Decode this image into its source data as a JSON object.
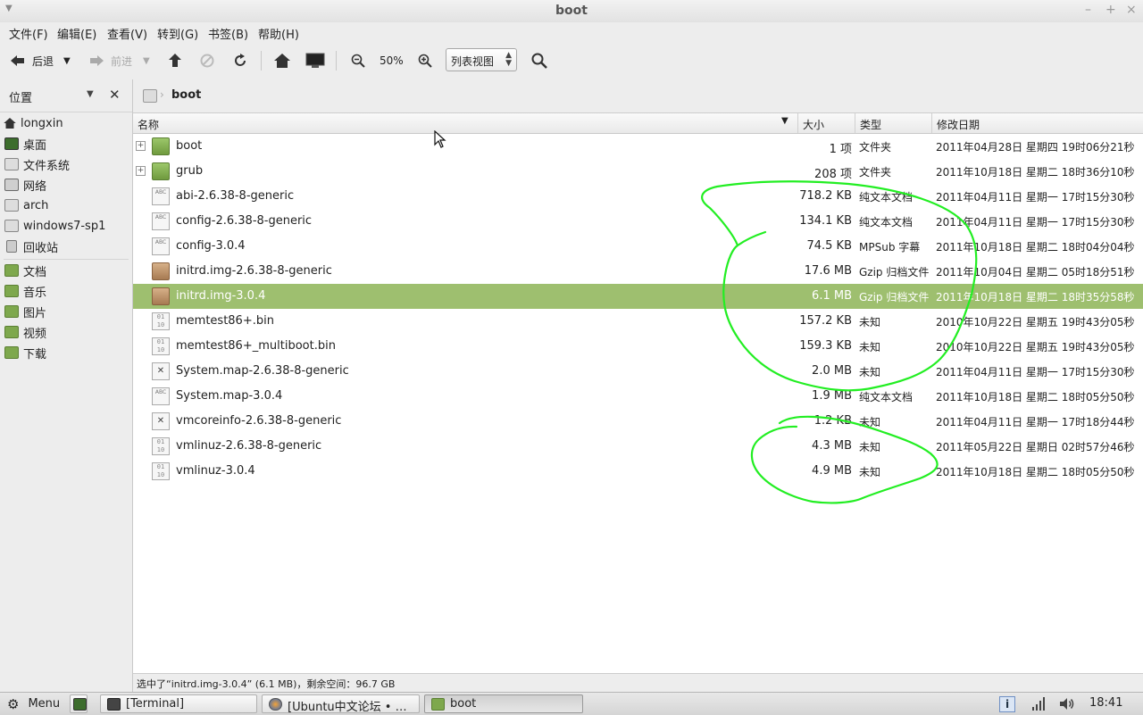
{
  "window": {
    "title": "boot"
  },
  "menubar": [
    "文件(F)",
    "编辑(E)",
    "查看(V)",
    "转到(G)",
    "书签(B)",
    "帮助(H)"
  ],
  "toolbar": {
    "back": "后退",
    "forward": "前进",
    "zoom": "50%",
    "view_mode": "列表视图"
  },
  "sidebar": {
    "title": "位置",
    "places": [
      {
        "label": "longxin",
        "icon": "home-icon"
      },
      {
        "label": "桌面",
        "icon": "desktop-icon"
      },
      {
        "label": "文件系统",
        "icon": "drive-icon"
      },
      {
        "label": "网络",
        "icon": "network-icon"
      },
      {
        "label": "arch",
        "icon": "drive-icon"
      },
      {
        "label": "windows7-sp1",
        "icon": "drive-icon"
      },
      {
        "label": "回收站",
        "icon": "trash-icon"
      }
    ],
    "bookmarks": [
      {
        "label": "文档",
        "icon": "folder-icon"
      },
      {
        "label": "音乐",
        "icon": "folder-icon"
      },
      {
        "label": "图片",
        "icon": "folder-icon"
      },
      {
        "label": "视频",
        "icon": "folder-icon"
      },
      {
        "label": "下载",
        "icon": "folder-icon"
      }
    ]
  },
  "pathbar": {
    "current": "boot"
  },
  "columns": {
    "name": "名称",
    "size": "大小",
    "type": "类型",
    "modified": "修改日期"
  },
  "files": [
    {
      "name": "boot",
      "size": "1 项",
      "type": "文件夹",
      "modified": "2011年04月28日 星期四 19时06分21秒",
      "icon": "folder",
      "expandable": true
    },
    {
      "name": "grub",
      "size": "208 项",
      "type": "文件夹",
      "modified": "2011年10月18日 星期二 18时36分10秒",
      "icon": "folder",
      "expandable": true
    },
    {
      "name": "abi-2.6.38-8-generic",
      "size": "718.2 KB",
      "type": "纯文本文档",
      "modified": "2011年04月11日 星期一 17时15分30秒",
      "icon": "text"
    },
    {
      "name": "config-2.6.38-8-generic",
      "size": "134.1 KB",
      "type": "纯文本文档",
      "modified": "2011年04月11日 星期一 17时15分30秒",
      "icon": "text"
    },
    {
      "name": "config-3.0.4",
      "size": "74.5 KB",
      "type": "MPSub 字幕",
      "modified": "2011年10月18日 星期二 18时04分04秒",
      "icon": "text"
    },
    {
      "name": "initrd.img-2.6.38-8-generic",
      "size": "17.6 MB",
      "type": "Gzip 归档文件",
      "modified": "2011年10月04日 星期二 05时18分51秒",
      "icon": "pkg"
    },
    {
      "name": "initrd.img-3.0.4",
      "size": "6.1 MB",
      "type": "Gzip 归档文件",
      "modified": "2011年10月18日 星期二 18时35分58秒",
      "icon": "pkg",
      "selected": true
    },
    {
      "name": "memtest86+.bin",
      "size": "157.2 KB",
      "type": "未知",
      "modified": "2010年10月22日 星期五 19时43分05秒",
      "icon": "bin"
    },
    {
      "name": "memtest86+_multiboot.bin",
      "size": "159.3 KB",
      "type": "未知",
      "modified": "2010年10月22日 星期五 19时43分05秒",
      "icon": "bin"
    },
    {
      "name": "System.map-2.6.38-8-generic",
      "size": "2.0 MB",
      "type": "未知",
      "modified": "2011年04月11日 星期一 17时15分30秒",
      "icon": "x"
    },
    {
      "name": "System.map-3.0.4",
      "size": "1.9 MB",
      "type": "纯文本文档",
      "modified": "2011年10月18日 星期二 18时05分50秒",
      "icon": "text"
    },
    {
      "name": "vmcoreinfo-2.6.38-8-generic",
      "size": "1.2 KB",
      "type": "未知",
      "modified": "2011年04月11日 星期一 17时18分44秒",
      "icon": "x"
    },
    {
      "name": "vmlinuz-2.6.38-8-generic",
      "size": "4.3 MB",
      "type": "未知",
      "modified": "2011年05月22日 星期日 02时57分46秒",
      "icon": "bin"
    },
    {
      "name": "vmlinuz-3.0.4",
      "size": "4.9 MB",
      "type": "未知",
      "modified": "2011年10月18日 星期二 18时05分50秒",
      "icon": "bin"
    }
  ],
  "statusbar": "选中了“initrd.img-3.0.4” (6.1 MB)，剩余空间：96.7 GB",
  "taskbar": {
    "menu": "Menu",
    "tasks": [
      {
        "label": "[Terminal]",
        "icon": "terminal-icon"
      },
      {
        "label": "[Ubuntu中文论坛 • …",
        "icon": "firefox-icon"
      },
      {
        "label": "boot",
        "icon": "folder-icon",
        "active": true
      }
    ],
    "clock": "18:41"
  },
  "colors": {
    "selection": "#9ebf6f",
    "annotation": "#22ee22",
    "folder": "#7ea84d"
  }
}
